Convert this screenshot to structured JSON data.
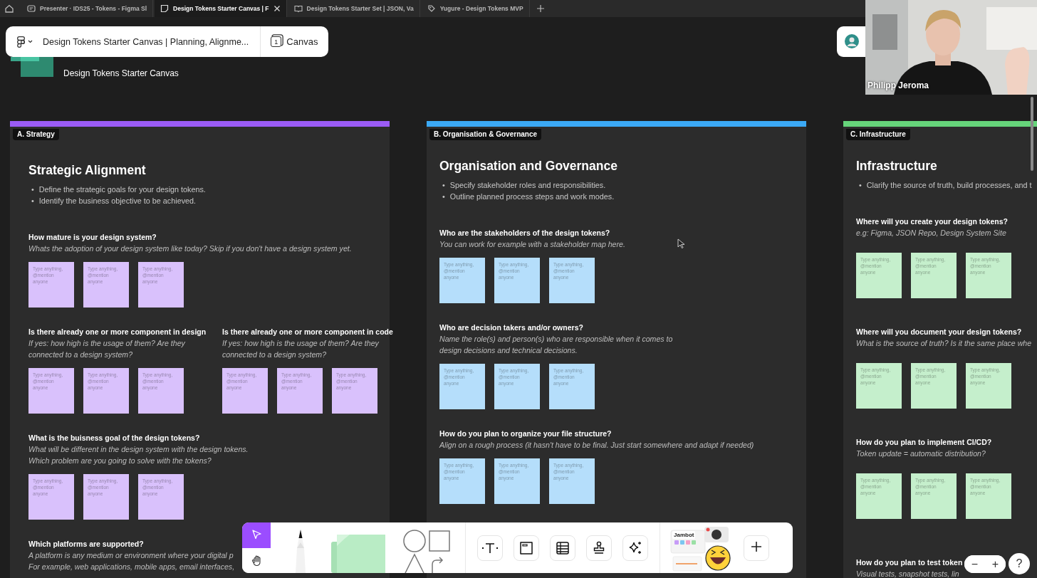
{
  "browser_tabs": [
    {
      "kind": "slides",
      "title": "Presenter · IDS25 - Tokens - Figma Sl",
      "selected": false
    },
    {
      "kind": "board",
      "title": "Design Tokens Starter Canvas | F",
      "selected": true
    },
    {
      "kind": "book",
      "title": "Design Tokens Starter Set | JSON, Va",
      "selected": false
    },
    {
      "kind": "tag",
      "title": "Yugure - Design Tokens MVP",
      "selected": false
    }
  ],
  "file_bar": {
    "title": "Design Tokens Starter Canvas | Planning, Alignme...",
    "page_number": "1",
    "page": "Canvas"
  },
  "header": {
    "subtitle": "Design Tokens Starter Canvas"
  },
  "video": {
    "name": "Philipp Jeroma"
  },
  "sections": [
    {
      "label": "A. Strategy",
      "color": "#9b5cf6",
      "title": "Strategic Alignment",
      "bullets": [
        {
          "marker": "•",
          "text": "Define the strategic goals for your design tokens."
        },
        {
          "marker": "•",
          "text": "Identify the business objective to be achieved."
        }
      ],
      "rows": [
        [
          {
            "question": "How mature is your design system?",
            "hint": "Whats the adoption of your design system like today? Skip if you don't have a design system yet.",
            "stickies": [
              {
                "placeholder": "Type anything, @mention anyone"
              },
              {
                "placeholder": "Type anything, @mention anyone"
              },
              {
                "placeholder": "Type anything, @mention anyone"
              }
            ]
          }
        ],
        [
          {
            "question": "Is there already one or more component in design",
            "hint": "If yes: how high is the usage of them? Are they\nconnected to a design system?",
            "stickies": [
              {
                "placeholder": "Type anything, @mention anyone"
              },
              {
                "placeholder": "Type anything, @mention anyone"
              },
              {
                "placeholder": "Type anything, @mention anyone"
              }
            ]
          },
          {
            "question": "Is there already one or more component in code",
            "hint": "If yes: how high is the usage of them? Are they\nconnected to a design system?",
            "stickies": [
              {
                "placeholder": "Type anything, @mention anyone"
              },
              {
                "placeholder": "Type anything, @mention anyone"
              },
              {
                "placeholder": "Type anything, @mention anyone"
              }
            ]
          }
        ],
        [
          {
            "question": "What is the buisness goal of the design tokens?",
            "hint": "What will be different in the design system with the design tokens.\nWhich problem are you going to solve with the tokens?",
            "stickies": [
              {
                "placeholder": "Type anything, @mention anyone"
              },
              {
                "placeholder": "Type anything, @mention anyone"
              },
              {
                "placeholder": "Type anything, @mention anyone"
              }
            ]
          }
        ],
        [
          {
            "question": "Which platforms are supported?",
            "hint": "A platform is any medium or environment where your digital p\nFor example, web applications, mobile apps, email interfaces,"
          }
        ]
      ]
    },
    {
      "label": "B. Organisation & Governance",
      "color": "#3ba9f5",
      "title": "Organisation and Governance",
      "bullets": [
        {
          "marker": "•",
          "text": "Specify stakeholder roles and responsibilities."
        },
        {
          "marker": "•",
          "text": "Outline planned process steps and work modes."
        }
      ],
      "rows": [
        [
          {
            "question": "Who are the stakeholders of the design tokens?",
            "hint": "You can work for example with a stakeholder map here.",
            "stickies": [
              {
                "placeholder": "Type anything, @mention anyone"
              },
              {
                "placeholder": "Type anything, @mention anyone"
              },
              {
                "placeholder": "Type anything, @mention anyone"
              }
            ]
          }
        ],
        [
          {
            "question": "Who are decision takers and/or owners?",
            "hint": "Name the role(s) and person(s) who are responsible when it comes to\ndesign decisions and technical decisions.",
            "stickies": [
              {
                "placeholder": "Type anything, @mention anyone"
              },
              {
                "placeholder": "Type anything, @mention anyone"
              },
              {
                "placeholder": "Type anything, @mention anyone"
              }
            ]
          }
        ],
        [
          {
            "question": "How do you plan to organize your file structure?",
            "hint": "Align on a rough process (it hasn't have to be final. Just start somewhere and adapt if needed)",
            "stickies": [
              {
                "placeholder": "Type anything, @mention anyone"
              },
              {
                "placeholder": "Type anything, @mention anyone"
              },
              {
                "placeholder": "Type anything, @mention anyone"
              }
            ]
          }
        ]
      ]
    },
    {
      "label": "C. Infrastructure",
      "color": "#66d47a",
      "title": "Infrastructure",
      "bullets": [
        {
          "marker": "•",
          "text": "Clarify the source of truth, build processes, and t"
        }
      ],
      "rows": [
        [
          {
            "question": "Where will you create your design tokens?",
            "hint": "e.g: Figma, JSON Repo, Design System Site",
            "stickies": [
              {
                "placeholder": "Type anything, @mention anyone"
              },
              {
                "placeholder": "Type anything, @mention anyone"
              },
              {
                "placeholder": "Type anything, @mention anyone"
              }
            ]
          }
        ],
        [
          {
            "question": "Where will you document your design tokens?",
            "hint": "What is the source of truth? Is it the same place whe",
            "stickies": [
              {
                "placeholder": "Type anything, @mention anyone"
              },
              {
                "placeholder": "Type anything, @mention anyone"
              },
              {
                "placeholder": "Type anything, @mention anyone"
              }
            ]
          }
        ],
        [
          {
            "question": "How do you plan to implement CI/CD?",
            "hint": "Token update = automatic distribution?",
            "stickies": [
              {
                "placeholder": "Type anything, @mention anyone"
              },
              {
                "placeholder": "Type anything, @mention anyone"
              },
              {
                "placeholder": "Type anything, @mention anyone"
              }
            ]
          }
        ],
        [
          {
            "question": "How do you plan to test token",
            "hint": "Visual tests, snapshot tests, lin"
          }
        ]
      ]
    }
  ],
  "toolbar": {
    "modes": [
      {
        "kind": "select",
        "selected": true
      },
      {
        "kind": "hand",
        "selected": false
      }
    ],
    "tools": [
      {
        "kind": "text",
        "selected": false
      },
      {
        "kind": "section",
        "selected": false
      },
      {
        "kind": "table",
        "selected": false
      },
      {
        "kind": "stamp",
        "selected": false
      },
      {
        "kind": "ai",
        "selected": false
      }
    ],
    "widgets_label": "Jambot"
  },
  "zoom_controls": {
    "zoom_out": "−",
    "zoom_in": "+",
    "help": "?"
  }
}
